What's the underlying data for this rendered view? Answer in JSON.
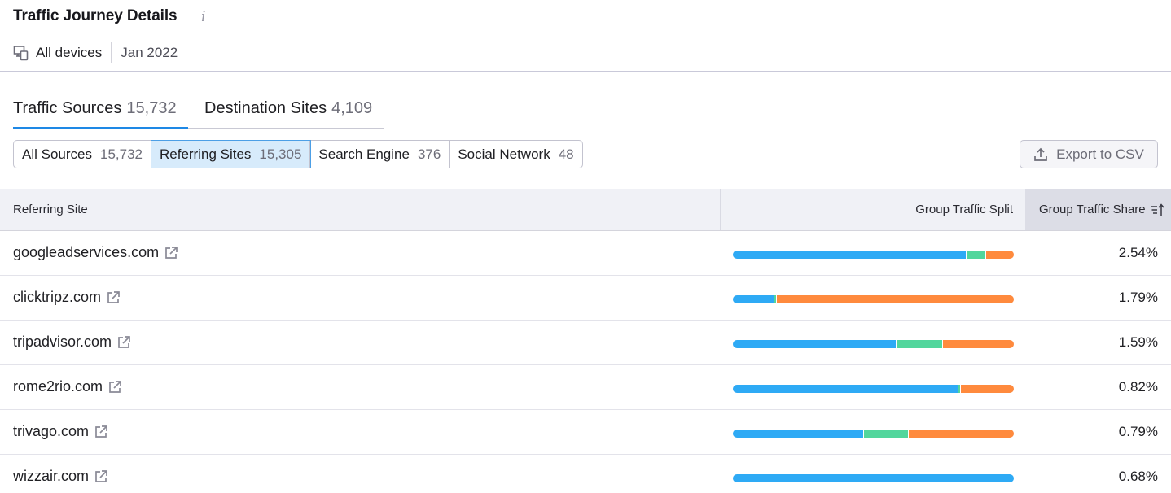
{
  "header": {
    "title": "Traffic Journey Details",
    "info_icon": "info-icon",
    "devices": "All devices",
    "date": "Jan 2022"
  },
  "tabs": [
    {
      "label": "Traffic Sources",
      "count": "15,732",
      "active": true
    },
    {
      "label": "Destination Sites",
      "count": "4,109",
      "active": false
    }
  ],
  "filters": [
    {
      "label": "All Sources",
      "count": "15,732",
      "active": false
    },
    {
      "label": "Referring Sites",
      "count": "15,305",
      "active": true
    },
    {
      "label": "Search Engine",
      "count": "376",
      "active": false
    },
    {
      "label": "Social Network",
      "count": "48",
      "active": false
    }
  ],
  "export_label": "Export to CSV",
  "table": {
    "columns": {
      "site": "Referring Site",
      "split": "Group Traffic Split",
      "share": "Group Traffic Share"
    },
    "split_colors": [
      "#2eaaf5",
      "#52d69c",
      "#ff8a3d"
    ],
    "rows": [
      {
        "site": "googleadservices.com",
        "split": [
          83,
          7,
          10
        ],
        "share": "2.54%"
      },
      {
        "site": "clicktripz.com",
        "split": [
          14.5,
          0.8,
          84.7
        ],
        "share": "1.79%"
      },
      {
        "site": "tripadvisor.com",
        "split": [
          58,
          16.5,
          25.5
        ],
        "share": "1.59%"
      },
      {
        "site": "rome2rio.com",
        "split": [
          80,
          1,
          19
        ],
        "share": "0.82%"
      },
      {
        "site": "trivago.com",
        "split": [
          46.5,
          15.8,
          37.7
        ],
        "share": "0.79%"
      },
      {
        "site": "wizzair.com",
        "split": [
          100,
          0,
          0
        ],
        "share": "0.68%"
      }
    ]
  }
}
